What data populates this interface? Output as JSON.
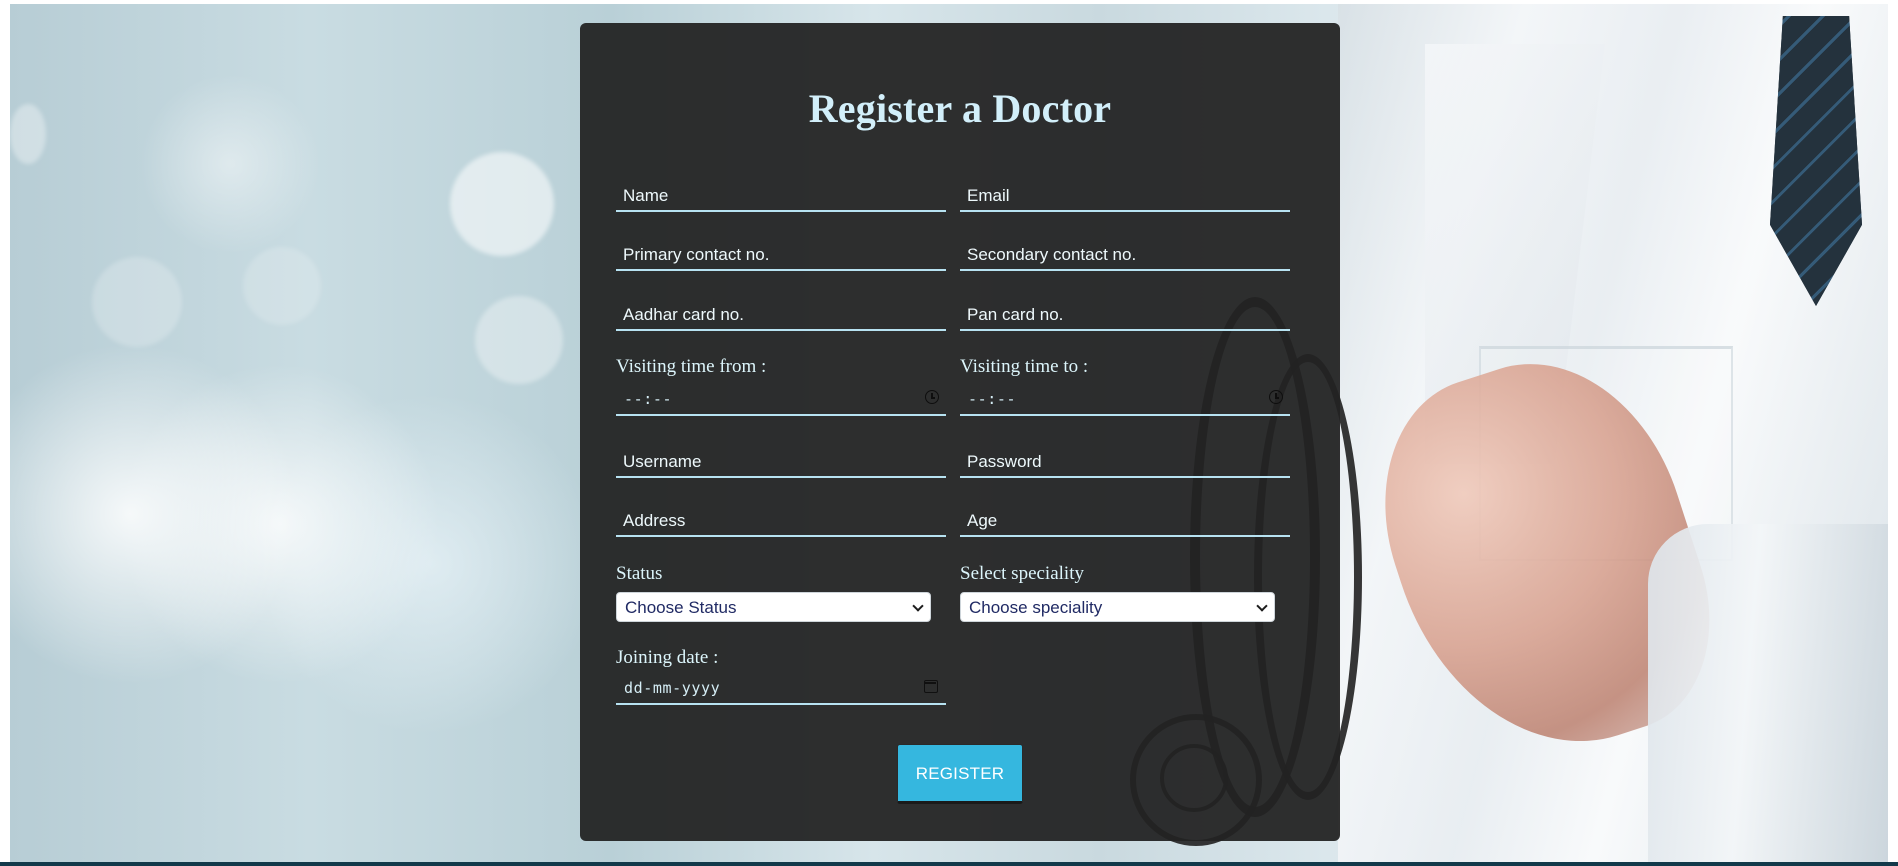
{
  "form": {
    "title": "Register a Doctor",
    "fields": {
      "name": {
        "placeholder": "Name",
        "value": ""
      },
      "email": {
        "placeholder": "Email",
        "value": ""
      },
      "primary_contact": {
        "placeholder": "Primary contact no.",
        "value": ""
      },
      "secondary_contact": {
        "placeholder": "Secondary contact no.",
        "value": ""
      },
      "aadhar": {
        "placeholder": "Aadhar card no.",
        "value": ""
      },
      "pan": {
        "placeholder": "Pan card no.",
        "value": ""
      },
      "username": {
        "placeholder": "Username",
        "value": ""
      },
      "password": {
        "placeholder": "Password",
        "value": ""
      },
      "address": {
        "placeholder": "Address",
        "value": ""
      },
      "age": {
        "placeholder": "Age",
        "value": ""
      }
    },
    "visiting_from": {
      "label": "Visiting time from :",
      "value": "--:--",
      "icon": "clock-icon"
    },
    "visiting_to": {
      "label": "Visiting time to :",
      "value": "--:--",
      "icon": "clock-icon"
    },
    "status": {
      "label": "Status",
      "selected": "Choose Status",
      "icon": "chevron-down-icon"
    },
    "speciality": {
      "label": "Select speciality",
      "selected": "Choose speciality",
      "icon": "chevron-down-icon"
    },
    "joining_date": {
      "label": "Joining date :",
      "value": "dd-mm-yyyy",
      "icon": "calendar-icon"
    },
    "register_button": "REGISTER"
  },
  "theme": {
    "panel_background": "#222222",
    "title_color": "#d2effa",
    "field_underline": "#b7e2f1",
    "button_color": "#35b7df",
    "select_text_color": "#202a64"
  },
  "background": {
    "subject": "doctor in white coat with stethoscope"
  }
}
